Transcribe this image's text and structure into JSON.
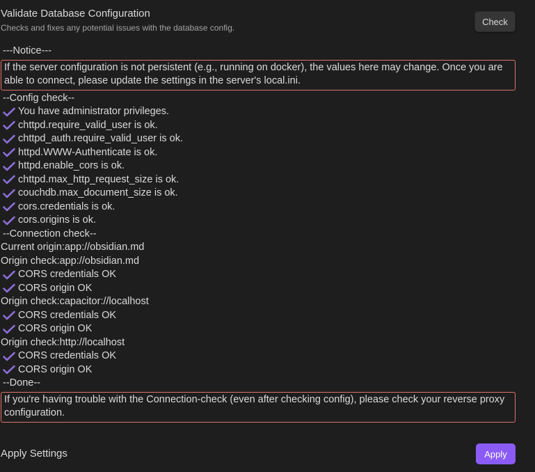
{
  "validate": {
    "title": "Validate Database Configuration",
    "description": "Checks and fixes any potential issues with the database config.",
    "check_button": "Check"
  },
  "log": {
    "notice_header": "---Notice---",
    "notice_text": "If the server configuration is not persistent (e.g., running on docker), the values here may change. Once you are able to connect, please update the settings in the server's local.ini.",
    "config_header": "--Config check--",
    "config_items": [
      "You have administrator privileges.",
      "chttpd.require_valid_user is ok.",
      "chttpd_auth.require_valid_user is ok.",
      "httpd.WWW-Authenticate is ok.",
      "httpd.enable_cors is ok.",
      "chttpd.max_http_request_size is ok.",
      "couchdb.max_document_size is ok.",
      "cors.credentials is ok.",
      "cors.origins is ok."
    ],
    "connection_header": "--Connection check--",
    "current_origin": "Current origin:app://obsidian.md",
    "origins": [
      {
        "label": "Origin check:app://obsidian.md",
        "results": [
          "CORS credentials OK",
          "CORS origin OK"
        ]
      },
      {
        "label": "Origin check:capacitor://localhost",
        "results": [
          "CORS credentials OK",
          "CORS origin OK"
        ]
      },
      {
        "label": "Origin check:http://localhost",
        "results": [
          "CORS credentials OK",
          "CORS origin OK"
        ]
      }
    ],
    "done_header": "--Done--",
    "done_text": "If you're having trouble with the Connection-check (even after checking config), please check your reverse proxy configuration."
  },
  "apply": {
    "label": "Apply Settings",
    "button": "Apply"
  },
  "colors": {
    "background": "#1e1e1e",
    "accent": "#8a5cf5",
    "checkmark": "#8a6fd6",
    "notice_border": "#e0746a"
  },
  "icons": {
    "ok": "check-icon"
  }
}
